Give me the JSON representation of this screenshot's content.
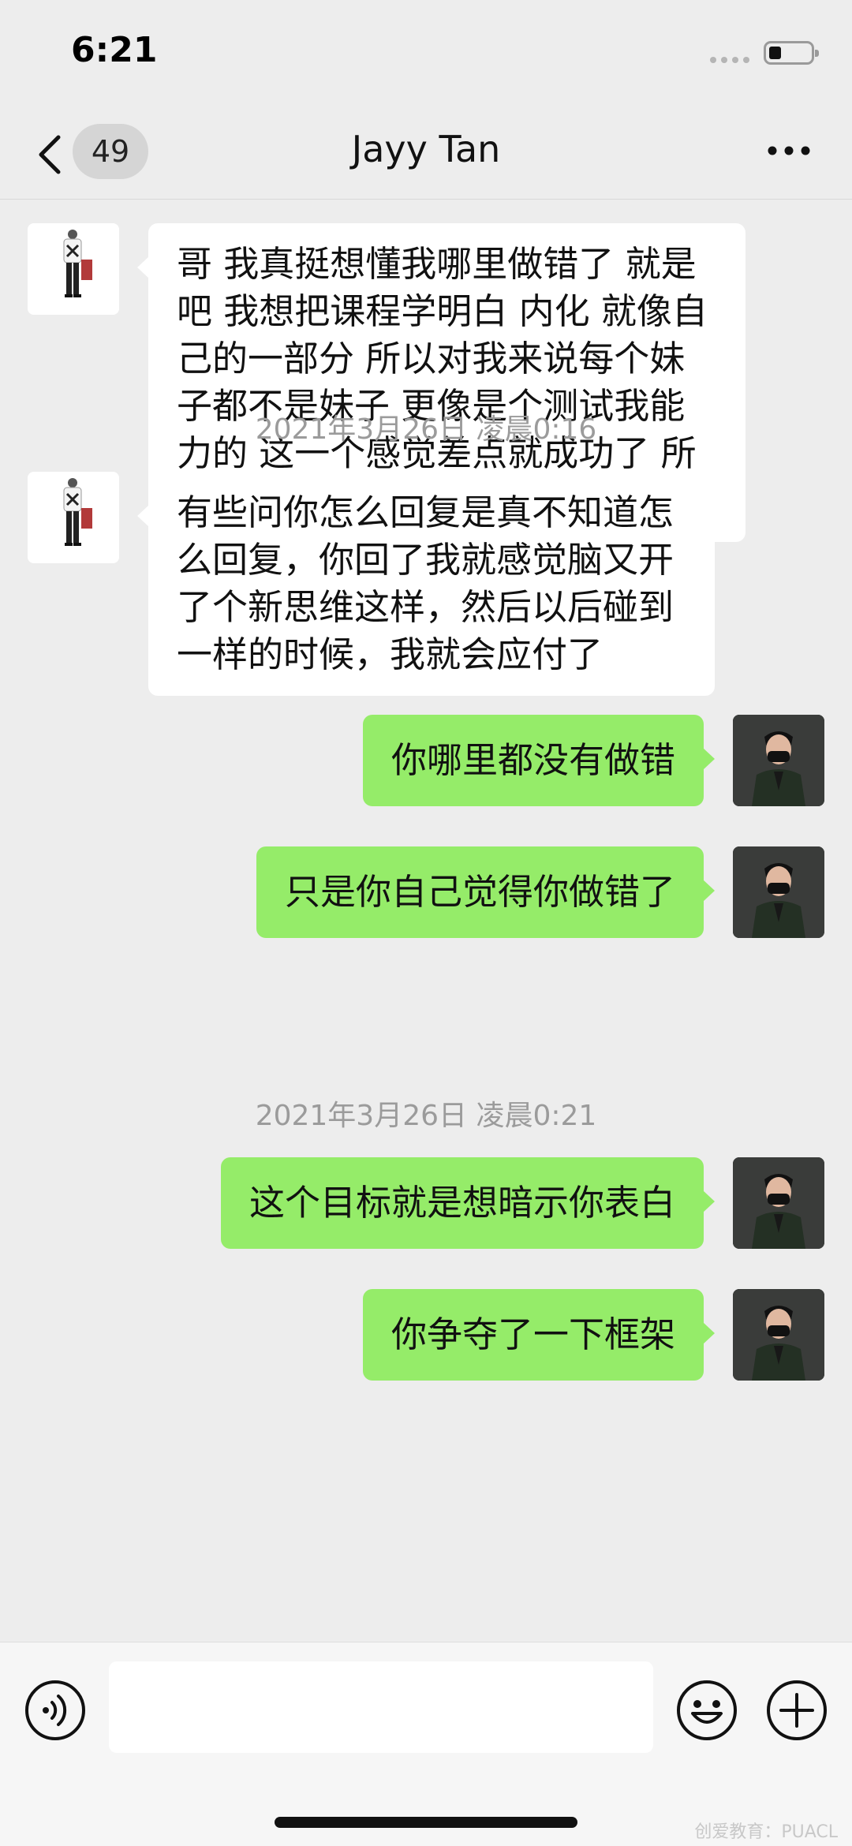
{
  "status_bar": {
    "time": "6:21"
  },
  "nav": {
    "unread_count": "49",
    "title": "Jayy Tan"
  },
  "messages": [
    {
      "sender": "contact",
      "text": "哥 我真挺想懂我哪里做错了 就是吧 我想把课程学明白 内化 就像自己的一部分 所以对我来说每个妹子都不是妹子 更像是个测试我能力的 这一个感觉差点就成功了 所以真的自责"
    },
    {
      "timestamp": "2021年3月26日 凌晨0:16"
    },
    {
      "sender": "contact",
      "text": "有些问你怎么回复是真不知道怎么回复，你回了我就感觉脑又开了个新思维这样，然后以后碰到一样的时候，我就会应付了"
    },
    {
      "sender": "me",
      "text": "你哪里都没有做错"
    },
    {
      "sender": "me",
      "text": "只是你自己觉得你做错了"
    },
    {
      "timestamp": "2021年3月26日 凌晨0:21"
    },
    {
      "sender": "me",
      "text": "这个目标就是想暗示你表白"
    },
    {
      "sender": "me",
      "text": "你争夺了一下框架"
    }
  ],
  "input": {
    "value": "",
    "placeholder": ""
  },
  "watermark": "创爱教育：PUACL",
  "colors": {
    "background": "#ededed",
    "outgoing_bubble": "#95ec69",
    "incoming_bubble": "#ffffff"
  },
  "icons": [
    "back-icon",
    "more-icon",
    "voice-icon",
    "emoji-icon",
    "plus-icon"
  ]
}
